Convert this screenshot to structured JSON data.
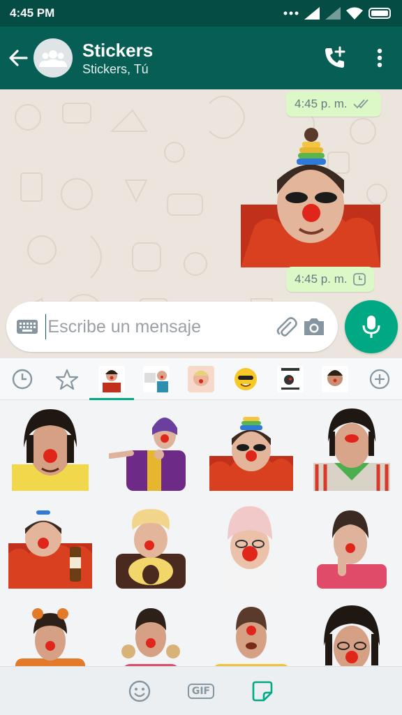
{
  "status_bar": {
    "time": "4:45 PM"
  },
  "header": {
    "title": "Stickers",
    "subtitle": "Stickers, Tú"
  },
  "messages": [
    {
      "type": "time",
      "time": "4:45 p. m.",
      "status": "read"
    },
    {
      "type": "sticker",
      "time": "4:45 p. m.",
      "status": "pending"
    }
  ],
  "composer": {
    "placeholder": "Escribe un mensaje"
  },
  "sticker_tabs": [
    "recent",
    "favorites",
    "pack-1",
    "pack-2",
    "pack-3",
    "pack-4",
    "pack-5",
    "pack-6",
    "add"
  ],
  "colors": {
    "header": "#075e54",
    "accent": "#00a884",
    "bubble": "#dcf8c6"
  }
}
